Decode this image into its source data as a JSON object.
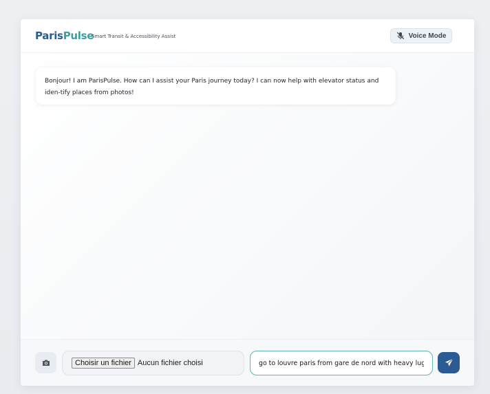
{
  "header": {
    "brand_part1": "Paris",
    "brand_part2": "Pulse",
    "tagline": "Smart Transit & Accessibility Assist",
    "voice_mode_label": "Voice Mode",
    "voice_icon": "microphone-off-icon"
  },
  "chat": {
    "messages": [
      {
        "role": "assistant",
        "text": "Bonjour! I am ParisPulse. How can I assist your Paris journey today? I can now help with elevator status and iden-tify places from photos!"
      }
    ]
  },
  "composer": {
    "camera_icon": "camera-icon",
    "file_button_label": "Choisir un fichier",
    "file_status": "Aucun fichier choisi",
    "message_value": "go to louvre paris from gare de nord with heavy lug",
    "send_icon": "paper-plane-icon"
  },
  "colors": {
    "brand_dark": "#2b5e8c",
    "brand_teal": "#3aa0a0",
    "send_button": "#2c5a92",
    "input_border": "#5fb6ad"
  }
}
